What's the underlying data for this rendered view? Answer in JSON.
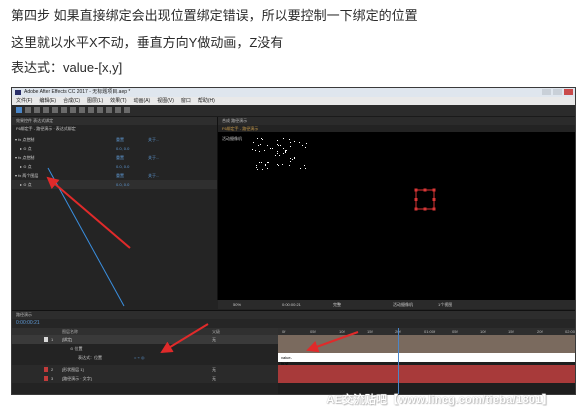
{
  "caption": {
    "line1": "第四步 如果直接绑定会出现位置绑定错误，所以要控制一下绑定的位置",
    "line2": "这里就以水平X不动，垂直方向Y做动画，Z没有",
    "line3": "表达式：value-[x,y]"
  },
  "app": {
    "title": "Adobe After Effects CC 2017 - 无标题项目.aep *",
    "menu": [
      "文件(F)",
      "编辑(E)",
      "合成(C)",
      "图层(L)",
      "效果(T)",
      "动画(A)",
      "视图(V)",
      "窗口",
      "帮助(H)"
    ]
  },
  "effect_controls": {
    "tab": "效果控件 表达式绑定",
    "breadcrumb": "F6绑定手 - 路径演示 · 表达式绑定",
    "rows": [
      {
        "label": "▾ fx 点控制",
        "reset": "重置",
        "about": "关于..."
      },
      {
        "label": "▸ ⊙ 点",
        "value": "0.0, 0.0"
      },
      {
        "label": "▾ fx 点控制",
        "reset": "重置",
        "about": "关于..."
      },
      {
        "label": "▸ ⊙ 点",
        "value": "0.0, 0.0"
      },
      {
        "label": "▾ fx 两个图层",
        "reset": "重置",
        "about": "关于..."
      },
      {
        "label": "▸ ⊙ 点",
        "value": "0.0, 0.0"
      }
    ]
  },
  "viewer": {
    "tab": "合成 路径演示",
    "breadcrumb": "F6绑定手 - 路径演示",
    "label": "活动摄像机",
    "zoom": "50%",
    "timecode": "0:00:00:21",
    "resolution": "完整",
    "camera": "活动摄像机",
    "views": "1个视图"
  },
  "timeline": {
    "tab": "路径演示",
    "current_time": "0:00:00:21",
    "headers": [
      "图层名称",
      "父级"
    ],
    "layers": [
      {
        "num": "1",
        "name": "[绑定]",
        "parent": "无",
        "color": "#d9d9d9"
      },
      {
        "num": "",
        "name": "⊙ 位置",
        "parent": "",
        "color": ""
      },
      {
        "num": "",
        "name": "表达式：位置",
        "parent": "",
        "color": ""
      },
      {
        "num": "2",
        "name": "[形状图层 1]",
        "parent": "无",
        "color": "#c23b3b"
      },
      {
        "num": "3",
        "name": "[路径演示 · 文字]",
        "parent": "无",
        "color": "#c23b3b"
      }
    ],
    "ticks": [
      "0f",
      "05f",
      "10f",
      "15f",
      "20f",
      "01:00f",
      "05f",
      "10f",
      "15f",
      "20f",
      "02:00f"
    ],
    "expression": "value-[x,y]"
  },
  "watermark": "AE交流贴吧【www.lincg.com/tieba/1801】",
  "colors": {
    "accent": "#4a86c8",
    "arrow_red": "#e02a2a",
    "arrow_blue": "#3a8fe0"
  }
}
